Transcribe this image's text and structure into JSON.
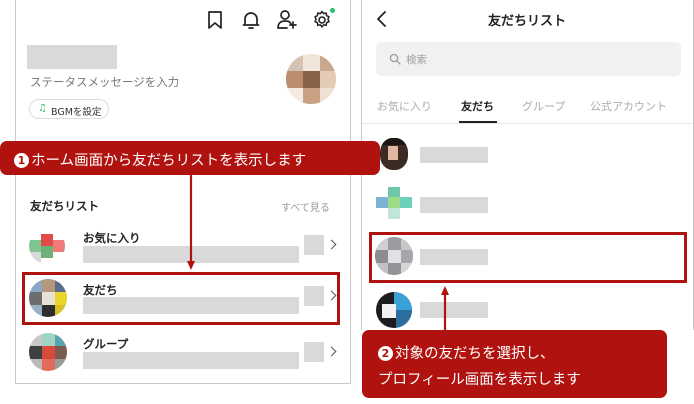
{
  "left_panel": {
    "status_message": "ステータスメッセージを入力",
    "bgm_button_label": "BGMを設定",
    "friends_list_heading": "友だちリスト",
    "see_all_link": "すべて見る",
    "rows": [
      {
        "label": "お気に入り"
      },
      {
        "label": "友だち"
      },
      {
        "label": "グループ"
      }
    ]
  },
  "right_panel": {
    "title": "友だちリスト",
    "search_placeholder": "検索",
    "tabs": [
      {
        "label": "お気に入り",
        "active": false
      },
      {
        "label": "友だち",
        "active": true
      },
      {
        "label": "グループ",
        "active": false
      },
      {
        "label": "公式アカウント",
        "active": false
      }
    ]
  },
  "callouts": {
    "step1": {
      "number": "1",
      "text": "ホーム画面から友だちリストを表示します"
    },
    "step2": {
      "number": "2",
      "line1": "対象の友だちを選択し、",
      "line2": "プロフィール画面を表示します"
    }
  },
  "colors": {
    "callout_red": "#b0120f",
    "notification_dot": "#2bc06a",
    "placeholder_gray": "#d9d9d9",
    "highlight_border": "#b0120f"
  }
}
